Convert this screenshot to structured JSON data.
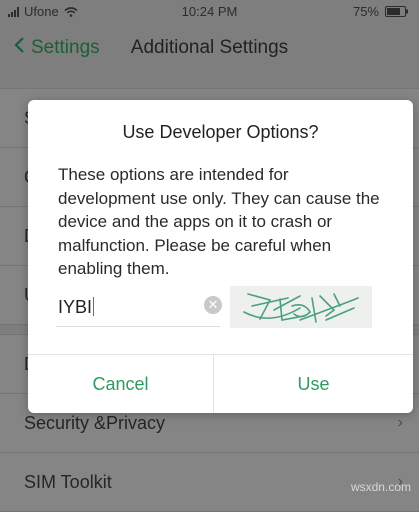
{
  "status_bar": {
    "carrier": "Ufone",
    "time": "10:24 PM",
    "battery": "75%"
  },
  "nav": {
    "back_label": "Settings",
    "title": "Additional Settings"
  },
  "background_list": {
    "group1": [
      "S",
      "C",
      "D",
      "U"
    ],
    "group2": [
      "D",
      "Security &Privacy",
      "SIM Toolkit"
    ]
  },
  "dialog": {
    "title": "Use Developer Options?",
    "message": "These options are intended for development use only. They can cause the device and the apps on it to crash or malfunction. Please be careful when enabling them.",
    "code_value": "IYBI",
    "captcha_text": "IYBI",
    "cancel_label": "Cancel",
    "use_label": "Use"
  },
  "watermark": "wsxdn.com",
  "colors": {
    "accent": "#2e9a5e",
    "back_link": "#1c5e3a"
  },
  "icons": [
    "signal-icon",
    "wifi-icon",
    "battery-icon",
    "back-chevron-icon",
    "chevron-right-icon",
    "clear-icon"
  ]
}
